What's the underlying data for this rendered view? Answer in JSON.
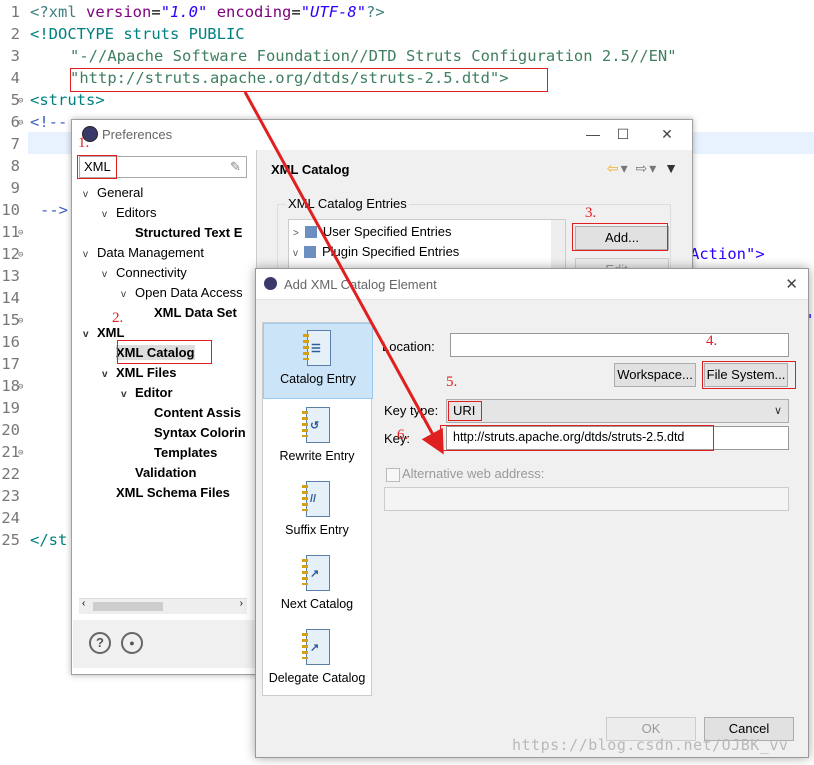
{
  "editor": {
    "line_numbers": [
      "1",
      "2",
      "3",
      "4",
      "5",
      "6",
      "7",
      "8",
      "9",
      "10",
      "11",
      "12",
      "13",
      "14",
      "15",
      "16",
      "17",
      "18",
      "19",
      "20",
      "21",
      "22",
      "23",
      "24",
      "25"
    ],
    "line1": {
      "open": "<?",
      "xml": "xml",
      "version_attr": "version",
      "eq": "=",
      "version_val": "\"1.0\"",
      "encoding_attr": "encoding",
      "encoding_val": "\"UTF-8\"",
      "close": "?>"
    },
    "line2": "<!DOCTYPE struts PUBLIC",
    "line3": "\"-//Apache Software Foundation//DTD Struts Configuration 2.5//EN\"",
    "line4": "\"http://struts.apache.org/dtds/struts-2.5.dtd\">",
    "line5": "<struts>",
    "line6": "<!--",
    "line10": "-->",
    "line12_fragment": "Action\">",
    "line15_fragment": "\"",
    "line25": "</st"
  },
  "preferences": {
    "title": "Preferences",
    "filter_text": "XML",
    "tree": [
      {
        "label": "General",
        "bold": false,
        "toggle": "v"
      },
      {
        "label": "Editors",
        "bold": false,
        "toggle": "v"
      },
      {
        "label": "Structured Text E",
        "bold": true,
        "toggle": ""
      },
      {
        "label": "Data Management",
        "bold": false,
        "toggle": "v"
      },
      {
        "label": "Connectivity",
        "bold": false,
        "toggle": "v"
      },
      {
        "label": "Open Data Access",
        "bold": false,
        "toggle": "v"
      },
      {
        "label": "XML Data Set",
        "bold": true,
        "toggle": ""
      },
      {
        "label": "XML",
        "bold": true,
        "toggle": "v"
      },
      {
        "label": "XML Catalog",
        "bold": true,
        "toggle": ""
      },
      {
        "label": "XML Files",
        "bold": true,
        "toggle": "v"
      },
      {
        "label": "Editor",
        "bold": true,
        "toggle": "v"
      },
      {
        "label": "Content Assis",
        "bold": true,
        "toggle": ""
      },
      {
        "label": "Syntax Colorin",
        "bold": true,
        "toggle": ""
      },
      {
        "label": "Templates",
        "bold": true,
        "toggle": ""
      },
      {
        "label": "Validation",
        "bold": true,
        "toggle": ""
      },
      {
        "label": "XML Schema Files",
        "bold": true,
        "toggle": ""
      }
    ],
    "page_title": "XML Catalog",
    "group_label": "XML Catalog Entries",
    "entries": [
      "User Specified Entries",
      "Plugin Specified Entries"
    ],
    "add_button": "Add...",
    "edit_button": "Edit..."
  },
  "dialog": {
    "title": "Add XML Catalog Element",
    "entry_types": [
      "Catalog Entry",
      "Rewrite Entry",
      "Suffix Entry",
      "Next Catalog",
      "Delegate Catalog"
    ],
    "location_label": "Location:",
    "location_value": "",
    "workspace_button": "Workspace...",
    "file_system_button": "File System...",
    "key_type_label": "Key type:",
    "key_type_value": "URI",
    "key_label": "Key:",
    "key_value": "http://struts.apache.org/dtds/struts-2.5.dtd",
    "alt_web_label": "Alternative web address:",
    "ok_button": "OK",
    "cancel_button": "Cancel"
  },
  "annotations": [
    "1.",
    "2.",
    "3.",
    "4.",
    "5.",
    "6."
  ],
  "watermark": "https://blog.csdn.net/OJBK_vv",
  "colors": {
    "annotation_red": "#e02020",
    "selection_blue": "#cce4f7"
  }
}
